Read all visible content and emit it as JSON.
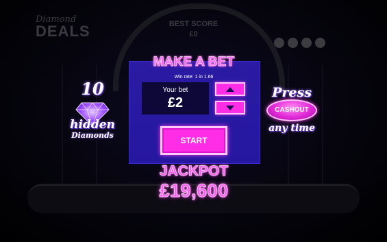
{
  "background": {
    "logo_small": "Diamond",
    "logo_big": "DEALS",
    "best_label": "BEST SCORE",
    "best_value": "£0",
    "dot_count": 4
  },
  "left_promo": {
    "count": "10",
    "label": "hidden",
    "sublabel": "Diamonds",
    "icon": "diamond-icon"
  },
  "right_promo": {
    "press": "Press",
    "button": "CASHOUT",
    "tail": "any time"
  },
  "bet_panel": {
    "title": "MAKE A BET",
    "win_rate": "Win rate: 1 in 1.66",
    "bet_label": "Your bet",
    "bet_value": "£2",
    "increase_icon": "arrow-up-icon",
    "decrease_icon": "arrow-down-icon",
    "start_label": "START"
  },
  "jackpot": {
    "label": "JACKPOT",
    "value": "£19,600"
  },
  "colors": {
    "accent": "#ff2de6",
    "panel": "#2a1a9a",
    "bet_box": "#0e0838"
  }
}
